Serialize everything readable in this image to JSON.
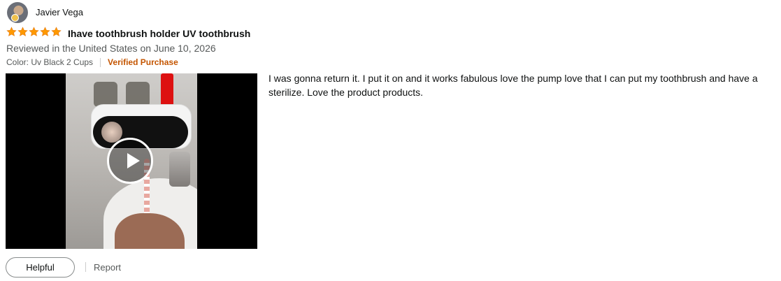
{
  "reviewer": {
    "name": "Javier Vega",
    "avatar_icon": "user-avatar"
  },
  "rating": {
    "value": 5,
    "max": 5,
    "star_color": "#ff9900"
  },
  "review": {
    "title": "Ihave toothbrush holder UV toothbrush",
    "date_line": "Reviewed in the United States on June 10, 2026",
    "variant": "Color: Uv Black 2 Cups",
    "verified_label": "Verified Purchase",
    "body": "I was gonna return it. I put it on and it works fabulous love the pump love that I can put my toothbrush and have a sterilize. Love the product products."
  },
  "media": {
    "type": "video",
    "play_icon": "play-icon"
  },
  "actions": {
    "helpful_label": "Helpful",
    "report_label": "Report"
  },
  "colors": {
    "verified": "#c45500",
    "secondary_text": "#565959"
  }
}
